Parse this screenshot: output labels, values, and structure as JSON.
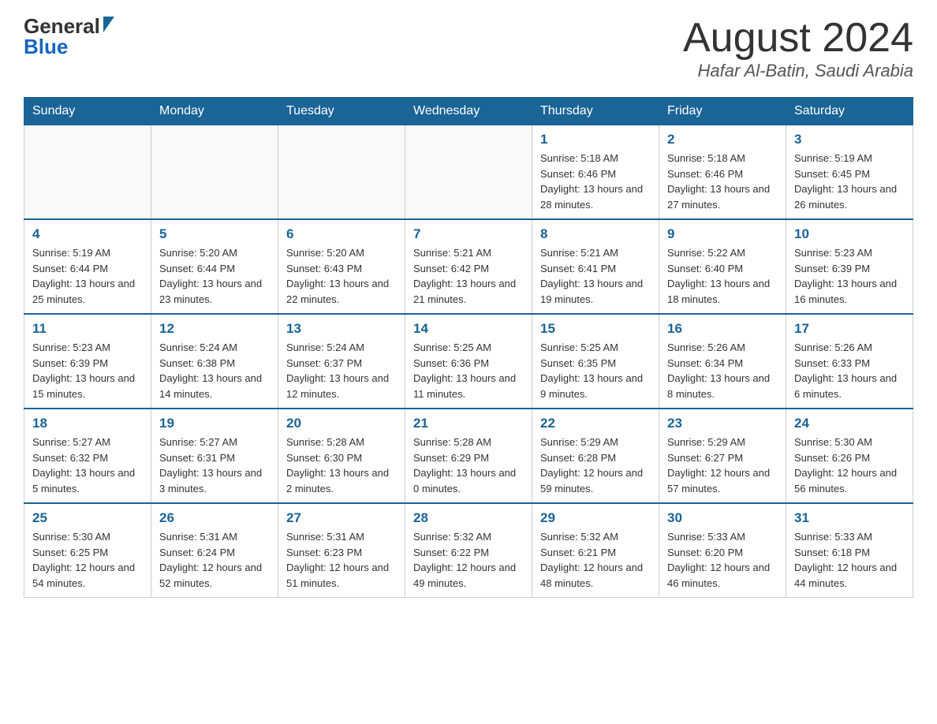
{
  "header": {
    "logo_general": "General",
    "logo_blue": "Blue",
    "month_title": "August 2024",
    "location": "Hafar Al-Batin, Saudi Arabia"
  },
  "weekdays": [
    "Sunday",
    "Monday",
    "Tuesday",
    "Wednesday",
    "Thursday",
    "Friday",
    "Saturday"
  ],
  "weeks": [
    [
      {
        "day": "",
        "info": ""
      },
      {
        "day": "",
        "info": ""
      },
      {
        "day": "",
        "info": ""
      },
      {
        "day": "",
        "info": ""
      },
      {
        "day": "1",
        "info": "Sunrise: 5:18 AM\nSunset: 6:46 PM\nDaylight: 13 hours and 28 minutes."
      },
      {
        "day": "2",
        "info": "Sunrise: 5:18 AM\nSunset: 6:46 PM\nDaylight: 13 hours and 27 minutes."
      },
      {
        "day": "3",
        "info": "Sunrise: 5:19 AM\nSunset: 6:45 PM\nDaylight: 13 hours and 26 minutes."
      }
    ],
    [
      {
        "day": "4",
        "info": "Sunrise: 5:19 AM\nSunset: 6:44 PM\nDaylight: 13 hours and 25 minutes."
      },
      {
        "day": "5",
        "info": "Sunrise: 5:20 AM\nSunset: 6:44 PM\nDaylight: 13 hours and 23 minutes."
      },
      {
        "day": "6",
        "info": "Sunrise: 5:20 AM\nSunset: 6:43 PM\nDaylight: 13 hours and 22 minutes."
      },
      {
        "day": "7",
        "info": "Sunrise: 5:21 AM\nSunset: 6:42 PM\nDaylight: 13 hours and 21 minutes."
      },
      {
        "day": "8",
        "info": "Sunrise: 5:21 AM\nSunset: 6:41 PM\nDaylight: 13 hours and 19 minutes."
      },
      {
        "day": "9",
        "info": "Sunrise: 5:22 AM\nSunset: 6:40 PM\nDaylight: 13 hours and 18 minutes."
      },
      {
        "day": "10",
        "info": "Sunrise: 5:23 AM\nSunset: 6:39 PM\nDaylight: 13 hours and 16 minutes."
      }
    ],
    [
      {
        "day": "11",
        "info": "Sunrise: 5:23 AM\nSunset: 6:39 PM\nDaylight: 13 hours and 15 minutes."
      },
      {
        "day": "12",
        "info": "Sunrise: 5:24 AM\nSunset: 6:38 PM\nDaylight: 13 hours and 14 minutes."
      },
      {
        "day": "13",
        "info": "Sunrise: 5:24 AM\nSunset: 6:37 PM\nDaylight: 13 hours and 12 minutes."
      },
      {
        "day": "14",
        "info": "Sunrise: 5:25 AM\nSunset: 6:36 PM\nDaylight: 13 hours and 11 minutes."
      },
      {
        "day": "15",
        "info": "Sunrise: 5:25 AM\nSunset: 6:35 PM\nDaylight: 13 hours and 9 minutes."
      },
      {
        "day": "16",
        "info": "Sunrise: 5:26 AM\nSunset: 6:34 PM\nDaylight: 13 hours and 8 minutes."
      },
      {
        "day": "17",
        "info": "Sunrise: 5:26 AM\nSunset: 6:33 PM\nDaylight: 13 hours and 6 minutes."
      }
    ],
    [
      {
        "day": "18",
        "info": "Sunrise: 5:27 AM\nSunset: 6:32 PM\nDaylight: 13 hours and 5 minutes."
      },
      {
        "day": "19",
        "info": "Sunrise: 5:27 AM\nSunset: 6:31 PM\nDaylight: 13 hours and 3 minutes."
      },
      {
        "day": "20",
        "info": "Sunrise: 5:28 AM\nSunset: 6:30 PM\nDaylight: 13 hours and 2 minutes."
      },
      {
        "day": "21",
        "info": "Sunrise: 5:28 AM\nSunset: 6:29 PM\nDaylight: 13 hours and 0 minutes."
      },
      {
        "day": "22",
        "info": "Sunrise: 5:29 AM\nSunset: 6:28 PM\nDaylight: 12 hours and 59 minutes."
      },
      {
        "day": "23",
        "info": "Sunrise: 5:29 AM\nSunset: 6:27 PM\nDaylight: 12 hours and 57 minutes."
      },
      {
        "day": "24",
        "info": "Sunrise: 5:30 AM\nSunset: 6:26 PM\nDaylight: 12 hours and 56 minutes."
      }
    ],
    [
      {
        "day": "25",
        "info": "Sunrise: 5:30 AM\nSunset: 6:25 PM\nDaylight: 12 hours and 54 minutes."
      },
      {
        "day": "26",
        "info": "Sunrise: 5:31 AM\nSunset: 6:24 PM\nDaylight: 12 hours and 52 minutes."
      },
      {
        "day": "27",
        "info": "Sunrise: 5:31 AM\nSunset: 6:23 PM\nDaylight: 12 hours and 51 minutes."
      },
      {
        "day": "28",
        "info": "Sunrise: 5:32 AM\nSunset: 6:22 PM\nDaylight: 12 hours and 49 minutes."
      },
      {
        "day": "29",
        "info": "Sunrise: 5:32 AM\nSunset: 6:21 PM\nDaylight: 12 hours and 48 minutes."
      },
      {
        "day": "30",
        "info": "Sunrise: 5:33 AM\nSunset: 6:20 PM\nDaylight: 12 hours and 46 minutes."
      },
      {
        "day": "31",
        "info": "Sunrise: 5:33 AM\nSunset: 6:18 PM\nDaylight: 12 hours and 44 minutes."
      }
    ]
  ]
}
